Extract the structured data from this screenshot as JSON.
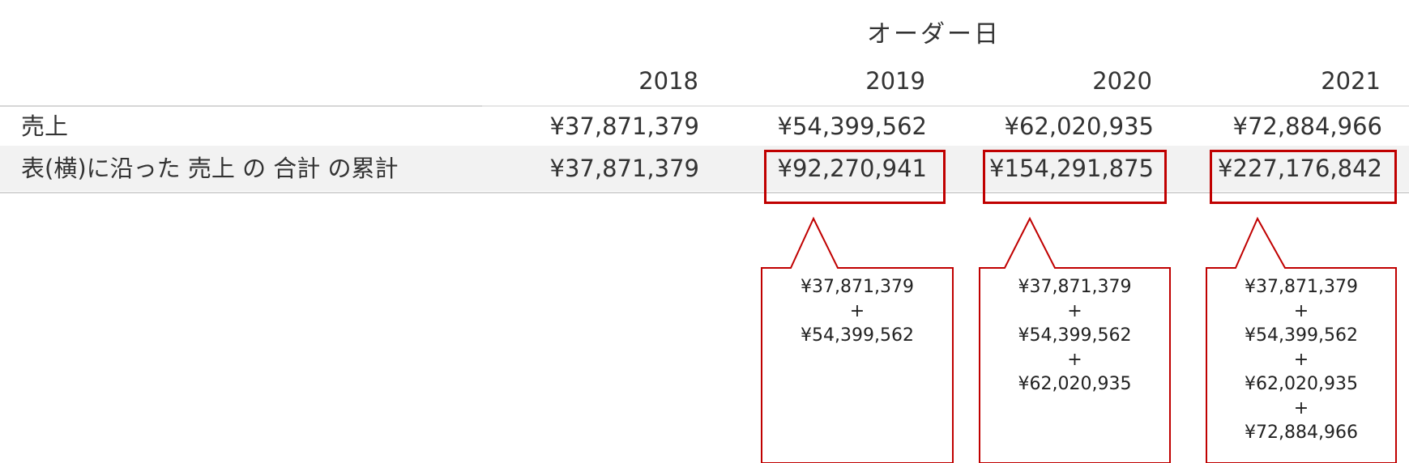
{
  "header": {
    "title": "オーダー日",
    "years": [
      "2018",
      "2019",
      "2020",
      "2021"
    ]
  },
  "rows": [
    {
      "label": "売上",
      "values": [
        "¥37,871,379",
        "¥54,399,562",
        "¥62,020,935",
        "¥72,884,966"
      ]
    },
    {
      "label": "表(横)に沿った 売上 の 合計 の累計",
      "values": [
        "¥37,871,379",
        "¥92,270,941",
        "¥154,291,875",
        "¥227,176,842"
      ]
    }
  ],
  "callouts": [
    {
      "lines": [
        "¥37,871,379",
        "+",
        "¥54,399,562"
      ]
    },
    {
      "lines": [
        "¥37,871,379",
        "+",
        "¥54,399,562",
        "+",
        "¥62,020,935"
      ]
    },
    {
      "lines": [
        "¥37,871,379",
        "+",
        "¥54,399,562",
        "+",
        "¥62,020,935",
        "+",
        "¥72,884,966"
      ]
    }
  ],
  "colors": {
    "highlight": "#c00000",
    "row_stripe": "#f2f2f2",
    "text": "#333333"
  }
}
